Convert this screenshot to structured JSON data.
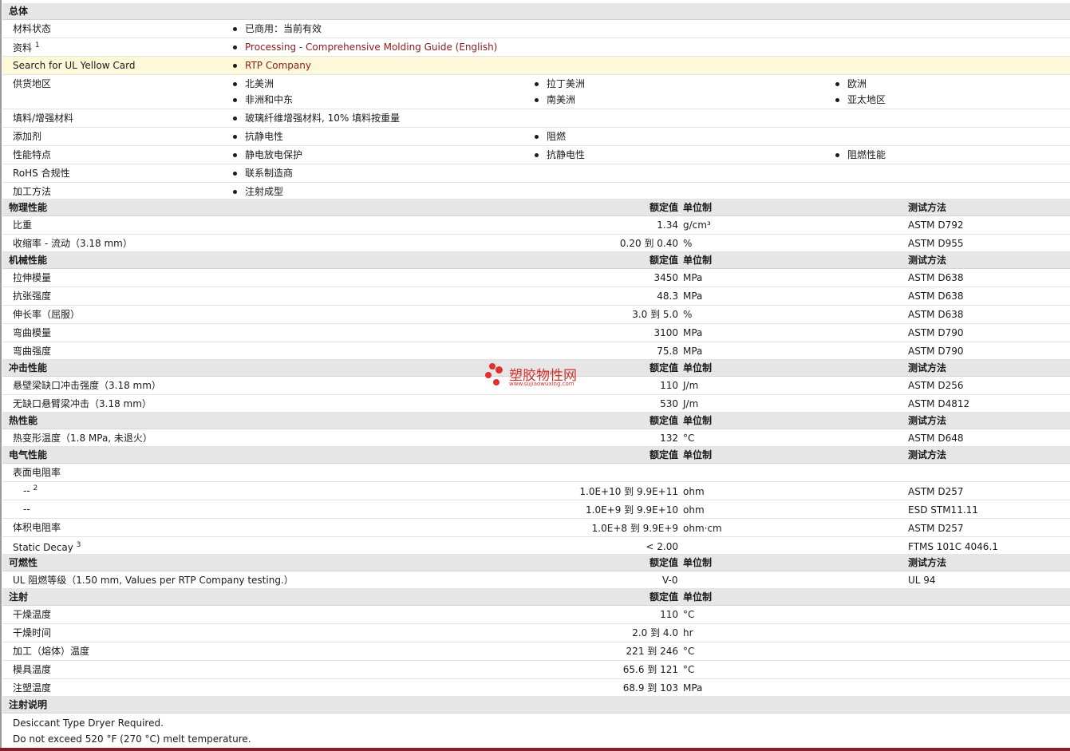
{
  "general": {
    "title": "总体",
    "material_status_label": "材料状态",
    "material_status_value": "已商用：当前有效",
    "docs_label": "资料",
    "docs_sup": "1",
    "docs_link": "Processing - Comprehensive Molding Guide (English)",
    "ul_label": "Search for UL Yellow Card",
    "ul_link": "RTP Company",
    "region_label": "供货地区",
    "regions": [
      "北美洲",
      "拉丁美洲",
      "欧洲",
      "非洲和中东",
      "南美洲",
      "亚太地区"
    ],
    "filler_label": "填料/增强材料",
    "filler_value": "玻璃纤维增强材料, 10% 填料按重量",
    "additive_label": "添加剂",
    "additives": [
      "抗静电性",
      "阻燃"
    ],
    "features_label": "性能特点",
    "features": [
      "静电放电保护",
      "抗静电性",
      "阻燃性能"
    ],
    "rohs_label": "RoHS 合规性",
    "rohs_value": "联系制造商",
    "process_label": "加工方法",
    "process_value": "注射成型"
  },
  "headers": {
    "nominal": "额定值",
    "unit": "单位制",
    "method": "测试方法"
  },
  "physical": {
    "title": "物理性能",
    "rows": [
      {
        "label": "比重",
        "value": "1.34",
        "unit": "g/cm³",
        "method": "ASTM D792"
      },
      {
        "label": "收缩率 - 流动（3.18 mm）",
        "value": "0.20 到  0.40",
        "unit": "%",
        "method": "ASTM D955"
      }
    ]
  },
  "mechanical": {
    "title": "机械性能",
    "rows": [
      {
        "label": "拉伸模量",
        "value": "3450",
        "unit": "MPa",
        "method": "ASTM D638"
      },
      {
        "label": "抗张强度",
        "value": "48.3",
        "unit": "MPa",
        "method": "ASTM D638"
      },
      {
        "label": "伸长率（屈服）",
        "value": "3.0 到  5.0",
        "unit": "%",
        "method": "ASTM D638"
      },
      {
        "label": "弯曲模量",
        "value": "3100",
        "unit": "MPa",
        "method": "ASTM D790"
      },
      {
        "label": "弯曲强度",
        "value": "75.8",
        "unit": "MPa",
        "method": "ASTM D790"
      }
    ]
  },
  "impact": {
    "title": "冲击性能",
    "rows": [
      {
        "label": "悬壁梁缺口冲击强度（3.18 mm）",
        "value": "110",
        "unit": "J/m",
        "method": "ASTM D256"
      },
      {
        "label": "无缺口悬臂梁冲击（3.18 mm）",
        "value": "530",
        "unit": "J/m",
        "method": "ASTM D4812"
      }
    ]
  },
  "thermal": {
    "title": "热性能",
    "rows": [
      {
        "label": "热变形温度（1.8 MPa, 未退火）",
        "value": "132",
        "unit": "°C",
        "method": "ASTM D648"
      }
    ]
  },
  "electrical": {
    "title": "电气性能",
    "surface_label": "表面电阻率",
    "sub1_label": "--",
    "sub1_sup": "2",
    "sub1_value": "1.0E+10 到  9.9E+11",
    "sub1_unit": "ohm",
    "sub1_method": "ASTM D257",
    "sub2_label": "--",
    "sub2_value": "1.0E+9 到  9.9E+10",
    "sub2_unit": "ohm",
    "sub2_method": "ESD STM11.11",
    "volume_label": "体积电阻率",
    "volume_value": "1.0E+8 到  9.9E+9",
    "volume_unit": "ohm·cm",
    "volume_method": "ASTM D257",
    "static_label": "Static Decay",
    "static_sup": "3",
    "static_value": "< 2.00",
    "static_method": "FTMS 101C 4046.1"
  },
  "flammability": {
    "title": "可燃性",
    "label": "UL 阻燃等级（1.50 mm, Values per RTP Company testing.）",
    "value": "V-0",
    "method": "UL 94"
  },
  "injection": {
    "title": "注射",
    "rows": [
      {
        "label": "干燥温度",
        "value": "110",
        "unit": "°C"
      },
      {
        "label": "干燥时间",
        "value": "2.0 到  4.0",
        "unit": "hr"
      },
      {
        "label": "加工（熔体）温度",
        "value": "221 到  246",
        "unit": "°C"
      },
      {
        "label": "模具温度",
        "value": "65.6 到  121",
        "unit": "°C"
      },
      {
        "label": "注塑温度",
        "value": "68.9 到  103",
        "unit": "MPa"
      }
    ]
  },
  "notes": {
    "title": "注射说明",
    "line1": "Desiccant Type Dryer Required.",
    "line2": "Do not exceed 520 °F (270 °C) melt temperature."
  },
  "watermark": {
    "cn": "塑胶物性网",
    "en": "www.sujiaowuxing.com"
  }
}
